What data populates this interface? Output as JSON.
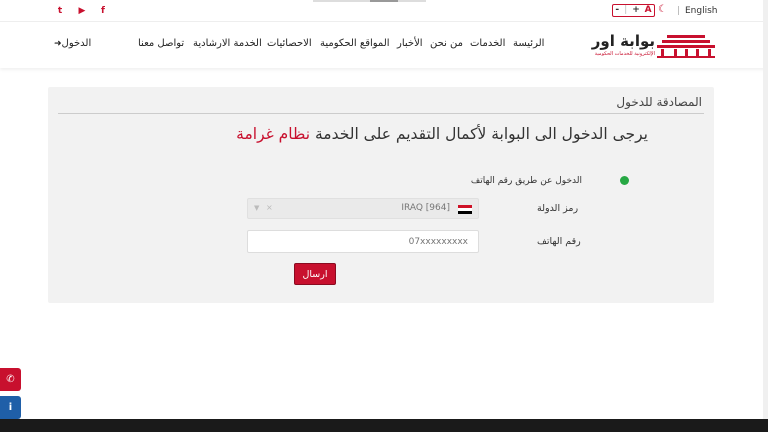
{
  "topbar": {
    "language": "English",
    "font_controls": [
      "-",
      "+",
      "A"
    ],
    "contrast_icon": "moon-icon",
    "social": [
      "facebook-icon",
      "youtube-icon",
      "twitter-icon"
    ]
  },
  "header": {
    "logo_name": "بوابة اور",
    "logo_sub": "الإلكترونية للخدمات الحكومية",
    "nav": [
      "الرئيسة",
      "الخدمات",
      "من نحن",
      "الأخبار",
      "المواقع الحكومية",
      "الاحصائيات",
      "الخدمة الارشادية",
      "تواصل معنا"
    ],
    "login": "الدخول",
    "login_icon": "sign-in-icon"
  },
  "auth": {
    "title": "المصادقة للدخول",
    "headline_prefix": "يرجى الدخول الى البوابة لأكمال التقديم على الخدمة",
    "headline_service": "نظام غرامة",
    "method_label": "الدخول عن طريق رقم الهاتف",
    "country_label": "رمز الدولة",
    "country_value": "IRAQ [964]",
    "phone_label": "رقم الهاتف",
    "phone_placeholder": "07xxxxxxxxx",
    "submit": "ارسال"
  },
  "side": {
    "phone_icon": "phone-icon",
    "info_icon": "info-icon"
  },
  "colors": {
    "accent": "#c8102e",
    "success": "#27a844",
    "info": "#1f5fa8"
  }
}
